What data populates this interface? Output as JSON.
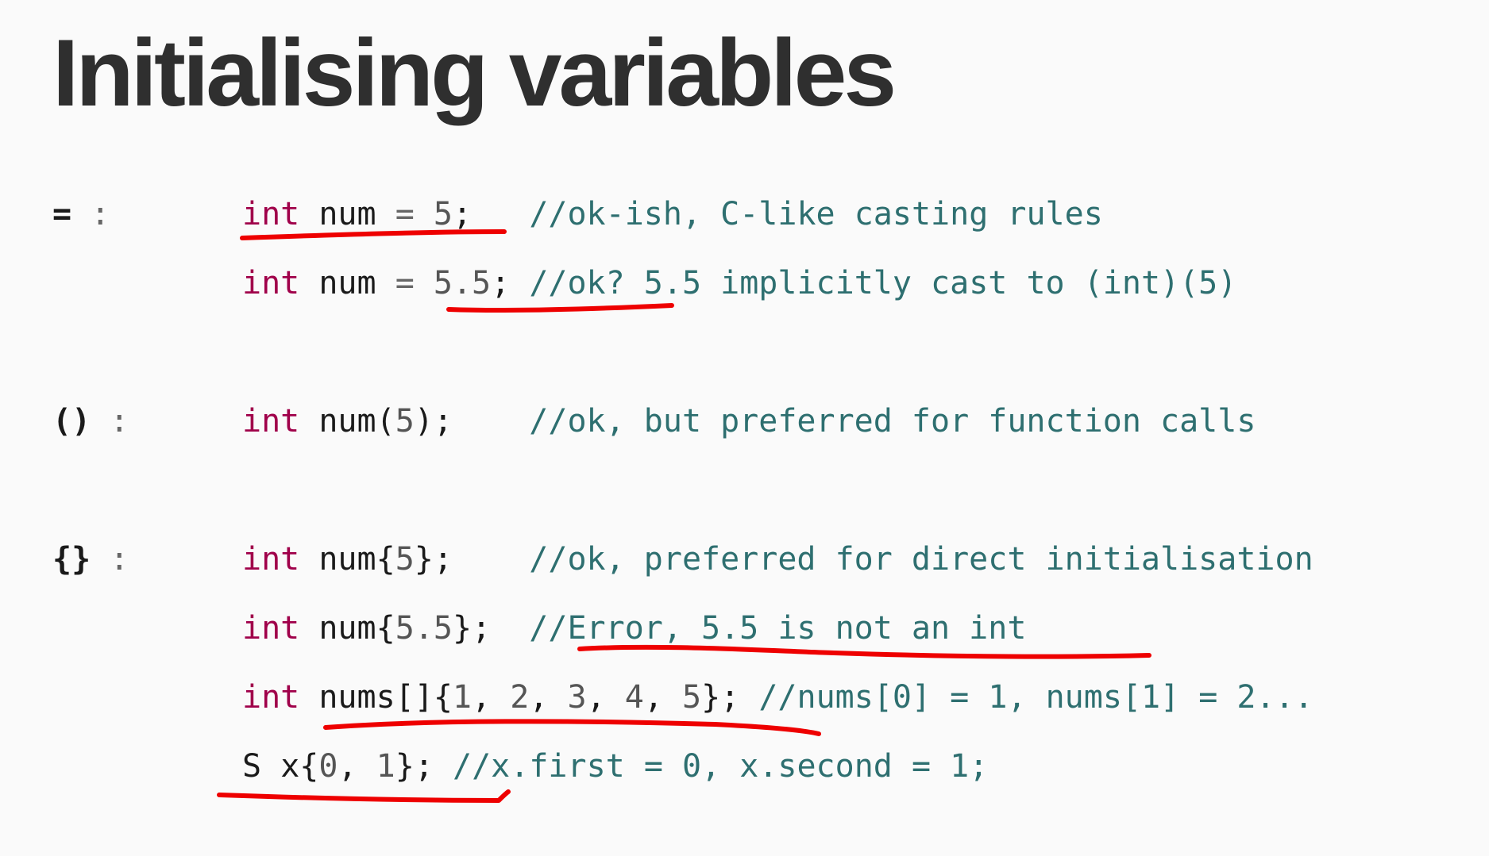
{
  "title": "Initialising variables",
  "sections": [
    {
      "symbol": "=",
      "colon": ":"
    },
    {
      "symbol": "()",
      "colon": ":"
    },
    {
      "symbol": "{}",
      "colon": ":"
    }
  ],
  "lines": [
    {
      "tokens": [
        {
          "t": "kw",
          "v": "int"
        },
        {
          "t": "sp",
          "v": " "
        },
        {
          "t": "id",
          "v": "num"
        },
        {
          "t": "sp",
          "v": " "
        },
        {
          "t": "op",
          "v": "="
        },
        {
          "t": "sp",
          "v": " "
        },
        {
          "t": "num",
          "v": "5"
        },
        {
          "t": "pun",
          "v": ";"
        },
        {
          "t": "sp",
          "v": "   "
        },
        {
          "t": "cm",
          "v": "//ok-ish, C-like casting rules"
        }
      ]
    },
    {
      "tokens": [
        {
          "t": "kw",
          "v": "int"
        },
        {
          "t": "sp",
          "v": " "
        },
        {
          "t": "id",
          "v": "num"
        },
        {
          "t": "sp",
          "v": " "
        },
        {
          "t": "op",
          "v": "="
        },
        {
          "t": "sp",
          "v": " "
        },
        {
          "t": "num",
          "v": "5.5"
        },
        {
          "t": "pun",
          "v": ";"
        },
        {
          "t": "sp",
          "v": " "
        },
        {
          "t": "cm",
          "v": "//ok? 5.5 implicitly cast to (int)(5)"
        }
      ]
    },
    {
      "tokens": [
        {
          "t": "kw",
          "v": "int"
        },
        {
          "t": "sp",
          "v": " "
        },
        {
          "t": "id",
          "v": "num"
        },
        {
          "t": "pun",
          "v": "("
        },
        {
          "t": "num",
          "v": "5"
        },
        {
          "t": "pun",
          "v": ");"
        },
        {
          "t": "sp",
          "v": "    "
        },
        {
          "t": "cm",
          "v": "//ok, but preferred for function calls"
        }
      ]
    },
    {
      "tokens": [
        {
          "t": "kw",
          "v": "int"
        },
        {
          "t": "sp",
          "v": " "
        },
        {
          "t": "id",
          "v": "num"
        },
        {
          "t": "pun",
          "v": "{"
        },
        {
          "t": "num",
          "v": "5"
        },
        {
          "t": "pun",
          "v": "};"
        },
        {
          "t": "sp",
          "v": "    "
        },
        {
          "t": "cm",
          "v": "//ok, preferred for direct initialisation"
        }
      ]
    },
    {
      "tokens": [
        {
          "t": "kw",
          "v": "int"
        },
        {
          "t": "sp",
          "v": " "
        },
        {
          "t": "id",
          "v": "num"
        },
        {
          "t": "pun",
          "v": "{"
        },
        {
          "t": "num",
          "v": "5.5"
        },
        {
          "t": "pun",
          "v": "};"
        },
        {
          "t": "sp",
          "v": "  "
        },
        {
          "t": "cm",
          "v": "//Error, 5.5 is not an int"
        }
      ]
    },
    {
      "tokens": [
        {
          "t": "kw",
          "v": "int"
        },
        {
          "t": "sp",
          "v": " "
        },
        {
          "t": "id",
          "v": "nums"
        },
        {
          "t": "pun",
          "v": "[]{"
        },
        {
          "t": "num",
          "v": "1"
        },
        {
          "t": "pun",
          "v": ", "
        },
        {
          "t": "num",
          "v": "2"
        },
        {
          "t": "pun",
          "v": ", "
        },
        {
          "t": "num",
          "v": "3"
        },
        {
          "t": "pun",
          "v": ", "
        },
        {
          "t": "num",
          "v": "4"
        },
        {
          "t": "pun",
          "v": ", "
        },
        {
          "t": "num",
          "v": "5"
        },
        {
          "t": "pun",
          "v": "};"
        },
        {
          "t": "sp",
          "v": " "
        },
        {
          "t": "cm",
          "v": "//nums[0] = 1, nums[1] = 2..."
        }
      ]
    },
    {
      "tokens": [
        {
          "t": "id",
          "v": "S"
        },
        {
          "t": "sp",
          "v": " "
        },
        {
          "t": "id",
          "v": "x"
        },
        {
          "t": "pun",
          "v": "{"
        },
        {
          "t": "num",
          "v": "0"
        },
        {
          "t": "pun",
          "v": ", "
        },
        {
          "t": "num",
          "v": "1"
        },
        {
          "t": "pun",
          "v": "};"
        },
        {
          "t": "sp",
          "v": " "
        },
        {
          "t": "cm",
          "v": "//x.first = 0, x.second = 1;"
        }
      ]
    }
  ],
  "colors": {
    "keyword": "#a0004a",
    "comment": "#2e6f70",
    "annotation": "#ee0000"
  }
}
